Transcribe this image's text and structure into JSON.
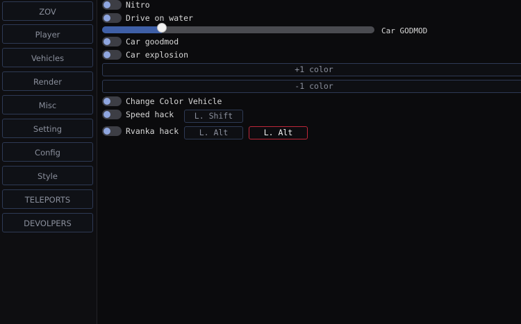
{
  "sidebar": {
    "items": [
      {
        "label": "ZOV"
      },
      {
        "label": "Player"
      },
      {
        "label": "Vehicles"
      },
      {
        "label": "Render"
      },
      {
        "label": "Misc"
      },
      {
        "label": "Setting"
      },
      {
        "label": "Config"
      },
      {
        "label": "Style"
      },
      {
        "label": "TELEPORTS"
      },
      {
        "label": "DEVOLPERS"
      }
    ]
  },
  "vehicles": {
    "nitro": {
      "label": "Nitro",
      "enabled": false
    },
    "drive_on_water": {
      "label": "Drive on water",
      "enabled": false
    },
    "slider": {
      "label": "Car GODMOD",
      "value_fraction": 0.22
    },
    "car_goodmod": {
      "label": "Car goodmod",
      "enabled": false
    },
    "car_explosion": {
      "label": "Car explosion",
      "enabled": false
    },
    "plus_color": {
      "label": "+1 color"
    },
    "minus_color": {
      "label": "-1 color"
    },
    "change_color": {
      "label": "Change Color Vehicle",
      "enabled": false
    },
    "speed_hack": {
      "label": "Speed hack",
      "enabled": false,
      "key": "L. Shift"
    },
    "rvanka_hack": {
      "label": "Rvanka hack",
      "enabled": false,
      "key": "L. Alt",
      "key2": "L. Alt"
    }
  },
  "colors": {
    "accent": "#3f5fa6",
    "active_border": "#c0273a",
    "knob": "#8fa6e0"
  }
}
